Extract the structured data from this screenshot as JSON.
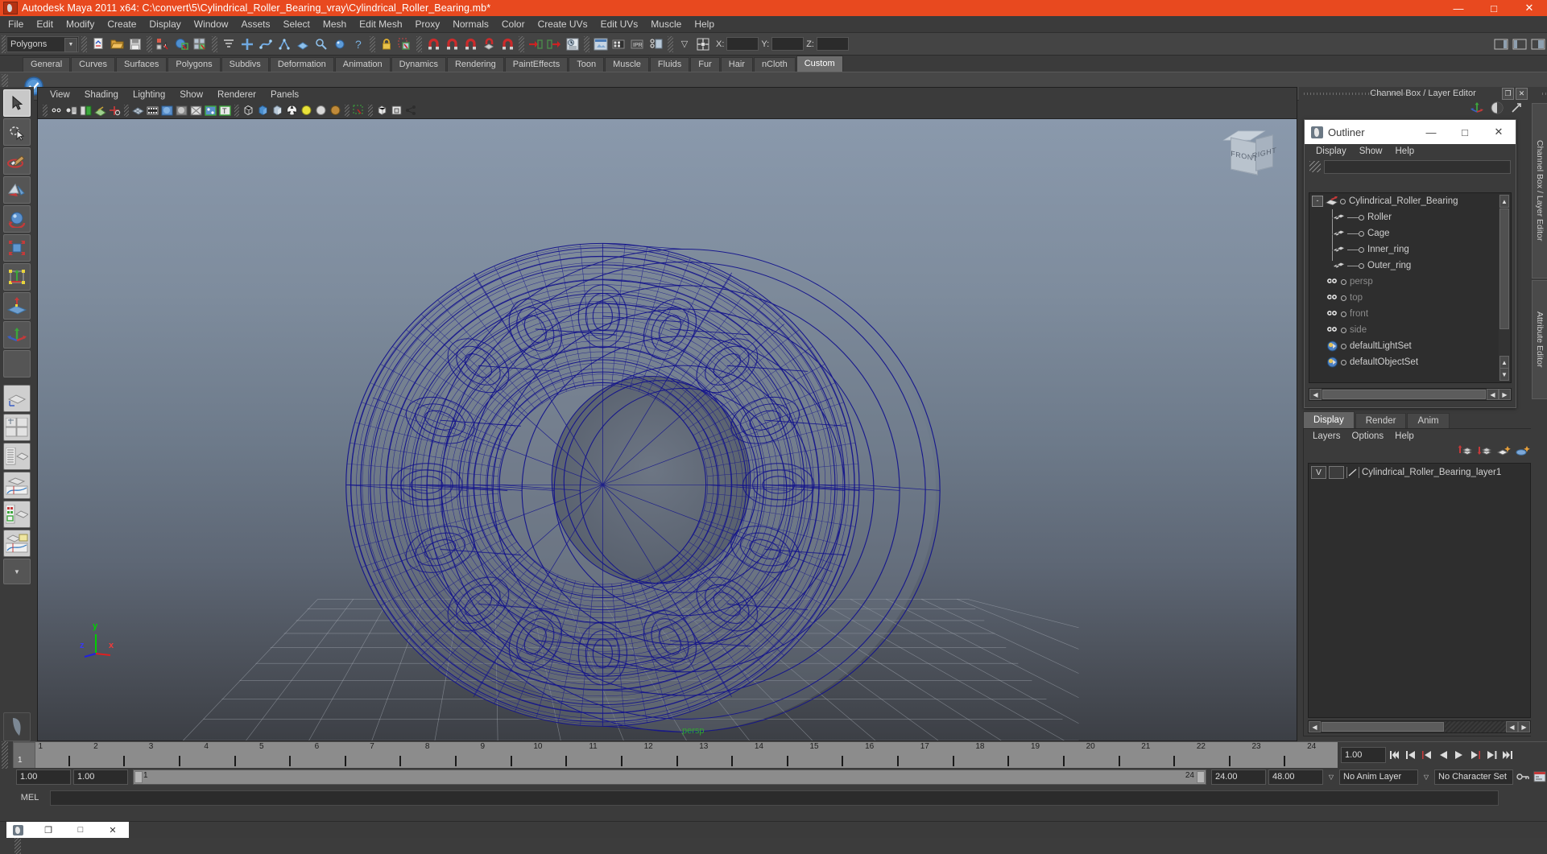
{
  "window": {
    "title": "Autodesk Maya 2011 x64: C:\\convert\\5\\Cylindrical_Roller_Bearing_vray\\Cylindrical_Roller_Bearing.mb*",
    "minimize": "—",
    "maximize": "□",
    "close": "✕",
    "accent": "#e8491f"
  },
  "menubar": {
    "items": [
      "File",
      "Edit",
      "Modify",
      "Create",
      "Display",
      "Window",
      "Assets",
      "Select",
      "Mesh",
      "Edit Mesh",
      "Proxy",
      "Normals",
      "Color",
      "Create UVs",
      "Edit UVs",
      "Muscle",
      "Help"
    ]
  },
  "toolbar": {
    "mode_select": "Polygons",
    "coords": {
      "x_label": "X:",
      "y_label": "Y:",
      "z_label": "Z:",
      "x_value": "",
      "y_value": "",
      "z_value": ""
    },
    "icons": [
      "new-scene-icon",
      "open-scene-icon",
      "save-scene-icon",
      "undo-icon",
      "redo-icon",
      "select-by-hierarchy-icon",
      "select-by-object-icon",
      "select-by-component-icon",
      "snap-grids-icon",
      "snap-curves-icon",
      "snap-points-icon",
      "snap-view-planes-icon",
      "snap-live-icon",
      "lock-icon",
      "construction-history-icon",
      "render-view-icon",
      "render-current-frame-icon",
      "ipr-render-icon",
      "render-settings-icon",
      "hypershade-icon"
    ]
  },
  "shelf": {
    "tabs": [
      "General",
      "Curves",
      "Surfaces",
      "Polygons",
      "Subdivs",
      "Deformation",
      "Animation",
      "Dynamics",
      "Rendering",
      "PaintEffects",
      "Toon",
      "Muscle",
      "Fluids",
      "Fur",
      "Hair",
      "nCloth",
      "Custom"
    ],
    "active_tab": "Custom",
    "buttons": [
      "vray-toolbar-icon"
    ]
  },
  "toolbox": {
    "items": [
      {
        "name": "select-tool",
        "active": true
      },
      {
        "name": "lasso-select-tool",
        "active": false
      },
      {
        "name": "paint-select-tool",
        "active": false
      },
      {
        "name": "move-tool",
        "active": false
      },
      {
        "name": "rotate-tool",
        "active": false
      },
      {
        "name": "scale-tool",
        "active": false
      },
      {
        "name": "universal-manipulator-tool",
        "active": false
      },
      {
        "name": "soft-modification-tool",
        "active": false
      },
      {
        "name": "show-manipulator-tool",
        "active": false
      },
      {
        "name": "last-tool-used",
        "active": false
      }
    ],
    "layouts": [
      {
        "name": "single-perspective-layout"
      },
      {
        "name": "four-view-layout"
      },
      {
        "name": "outliner-persp-layout"
      },
      {
        "name": "persp-graph-layout"
      },
      {
        "name": "hypershade-persp-layout"
      },
      {
        "name": "persp-graph-outliner-layout"
      },
      {
        "name": "layout-menu"
      }
    ]
  },
  "viewport": {
    "menus": [
      "View",
      "Shading",
      "Lighting",
      "Show",
      "Renderer",
      "Panels"
    ],
    "tool_icons": [
      "select-camera-icon",
      "camera-attributes-icon",
      "bookmarks-icon",
      "image-plane-icon",
      "two-d-pan-zoom-icon",
      "grid-icon",
      "film-gate-icon",
      "resolution-gate-icon",
      "gate-mask-icon",
      "xray-icon",
      "xray-joints-icon",
      "texture-icon",
      "wireframe-icon",
      "smooth-shade-all-icon",
      "smooth-shade-selected-icon",
      "hardware-texturing-icon",
      "lighting-default-icon",
      "lighting-all-icon",
      "lighting-shadows-icon",
      "high-quality-render-icon",
      "isolate-select-icon",
      "xray-mode-icon",
      "xray-active-icon",
      "shared-icon"
    ],
    "viewcube": {
      "front": "FRONT",
      "right": "RIGHT",
      "top": ""
    },
    "axis": {
      "x": "x",
      "y": "y",
      "z": "z"
    },
    "status_text": "persp",
    "model": {
      "name": "Cylindrical_Roller_Bearing",
      "display": "wireframe",
      "wire_color": "#14148c",
      "background_top": "#8a99ac",
      "background_bottom": "#3c3f45"
    }
  },
  "right_panel": {
    "channel_box_title": "Channel Box / Layer Editor",
    "restore_icon": "restore-icon",
    "close_icon": "close-icon",
    "header_icons": [
      "manipulator-icon",
      "layer-icon",
      "expand-icon"
    ],
    "vertical_tabs": [
      "Channel Box / Layer Editor",
      "Attribute Editor"
    ]
  },
  "outliner": {
    "title": "Outliner",
    "minimize": "—",
    "maximize": "□",
    "close": "✕",
    "menus": [
      "Display",
      "Show",
      "Help"
    ],
    "search_value": "",
    "nodes": [
      {
        "label": "Cylindrical_Roller_Bearing",
        "icon": "transform-icon",
        "depth": 0,
        "dim": false,
        "expander": "-"
      },
      {
        "label": "Roller",
        "icon": "mesh-icon",
        "depth": 1,
        "dim": false
      },
      {
        "label": "Cage",
        "icon": "mesh-icon",
        "depth": 1,
        "dim": false
      },
      {
        "label": "Inner_ring",
        "icon": "mesh-icon",
        "depth": 1,
        "dim": false
      },
      {
        "label": "Outer_ring",
        "icon": "mesh-icon",
        "depth": 1,
        "dim": false
      },
      {
        "label": "persp",
        "icon": "camera-icon",
        "depth": 0,
        "dim": true
      },
      {
        "label": "top",
        "icon": "camera-icon",
        "depth": 0,
        "dim": true
      },
      {
        "label": "front",
        "icon": "camera-icon",
        "depth": 0,
        "dim": true
      },
      {
        "label": "side",
        "icon": "camera-icon",
        "depth": 0,
        "dim": true
      },
      {
        "label": "defaultLightSet",
        "icon": "set-icon",
        "depth": 0,
        "dim": false
      },
      {
        "label": "defaultObjectSet",
        "icon": "set-icon",
        "depth": 0,
        "dim": false
      }
    ]
  },
  "layer_editor": {
    "tabs": [
      "Display",
      "Render",
      "Anim"
    ],
    "active_tab": "Display",
    "menus": [
      "Layers",
      "Options",
      "Help"
    ],
    "toolbar_icons": [
      "move-layer-up-icon",
      "move-layer-down-icon",
      "new-layer-icon",
      "new-layer-from-selected-icon"
    ],
    "layers": [
      {
        "visibility": "V",
        "shading": "",
        "type_icon": "layer-type-icon",
        "name": "Cylindrical_Roller_Bearing_layer1"
      }
    ]
  },
  "timeline": {
    "ticks": [
      "1",
      "2",
      "3",
      "4",
      "5",
      "6",
      "7",
      "8",
      "9",
      "10",
      "11",
      "12",
      "13",
      "14",
      "15",
      "16",
      "17",
      "18",
      "19",
      "20",
      "21",
      "22",
      "23",
      "24"
    ],
    "current_frame_label": "1",
    "current_frame_field": "1.00",
    "playback_buttons": [
      "go-to-start-icon",
      "step-back-key-icon",
      "step-back-frame-icon",
      "play-backwards-icon",
      "play-forwards-icon",
      "step-forward-frame-icon",
      "step-forward-key-icon",
      "go-to-end-icon"
    ]
  },
  "range_bar": {
    "anim_start": "1.00",
    "range_start": "1.00",
    "range_slider_start": "1",
    "range_slider_end": "24",
    "range_end": "24.00",
    "anim_end": "48.00",
    "anim_layer": "No Anim Layer",
    "character_set": "No Character Set",
    "key_icon": "auto-keyframe-icon",
    "prefs_icon": "animation-preferences-icon"
  },
  "command_line": {
    "language_label": "MEL",
    "value": "",
    "placeholder": ""
  },
  "taskbar": {
    "window_label": "",
    "buttons": [
      "restore-icon",
      "maximize-icon",
      "close-icon"
    ]
  }
}
